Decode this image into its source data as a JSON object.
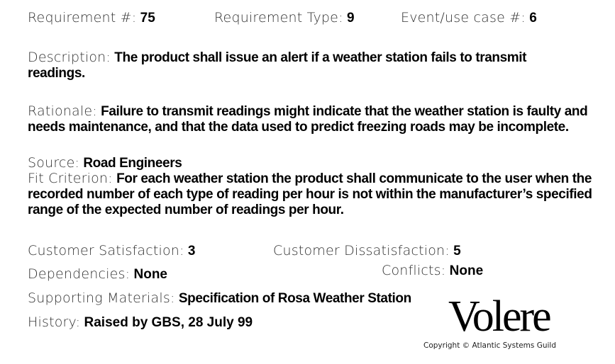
{
  "header": {
    "req_num_label": "Requirement #:",
    "req_num_value": "75",
    "req_type_label": "Requirement Type:",
    "req_type_value": "9",
    "event_label": "Event/use case #:",
    "event_value": "6"
  },
  "description": {
    "label": "Description:",
    "value": "The product shall issue an alert if a weather station fails to transmit readings."
  },
  "rationale": {
    "label": "Rationale:",
    "value": "Failure to transmit readings might indicate that the weather station is faulty and needs maintenance, and that the data used to predict freezing roads may be incomplete."
  },
  "source": {
    "label": "Source:",
    "value": "Road Engineers"
  },
  "fit_criterion": {
    "label": "Fit Criterion:",
    "value": "For each weather station the product shall communicate to the user when the recorded number of each type of reading per hour is not within the manufacturer’s specified range of the expected number of readings per hour."
  },
  "customer_satisfaction": {
    "label": "Customer Satisfaction:",
    "value": "3"
  },
  "customer_dissatisfaction": {
    "label": "Customer Dissatisfaction:",
    "value": "5"
  },
  "dependencies": {
    "label": "Dependencies:",
    "value": "None"
  },
  "conflicts": {
    "label": "Conflicts:",
    "value": "None"
  },
  "supporting_materials": {
    "label": "Supporting Materials:",
    "value": "Specification of Rosa Weather Station"
  },
  "history": {
    "label": "History:",
    "value": "Raised by GBS, 28 July 99"
  },
  "logo": {
    "text": "Volere",
    "copyright": "Copyright © Atlantic Systems Guild"
  }
}
